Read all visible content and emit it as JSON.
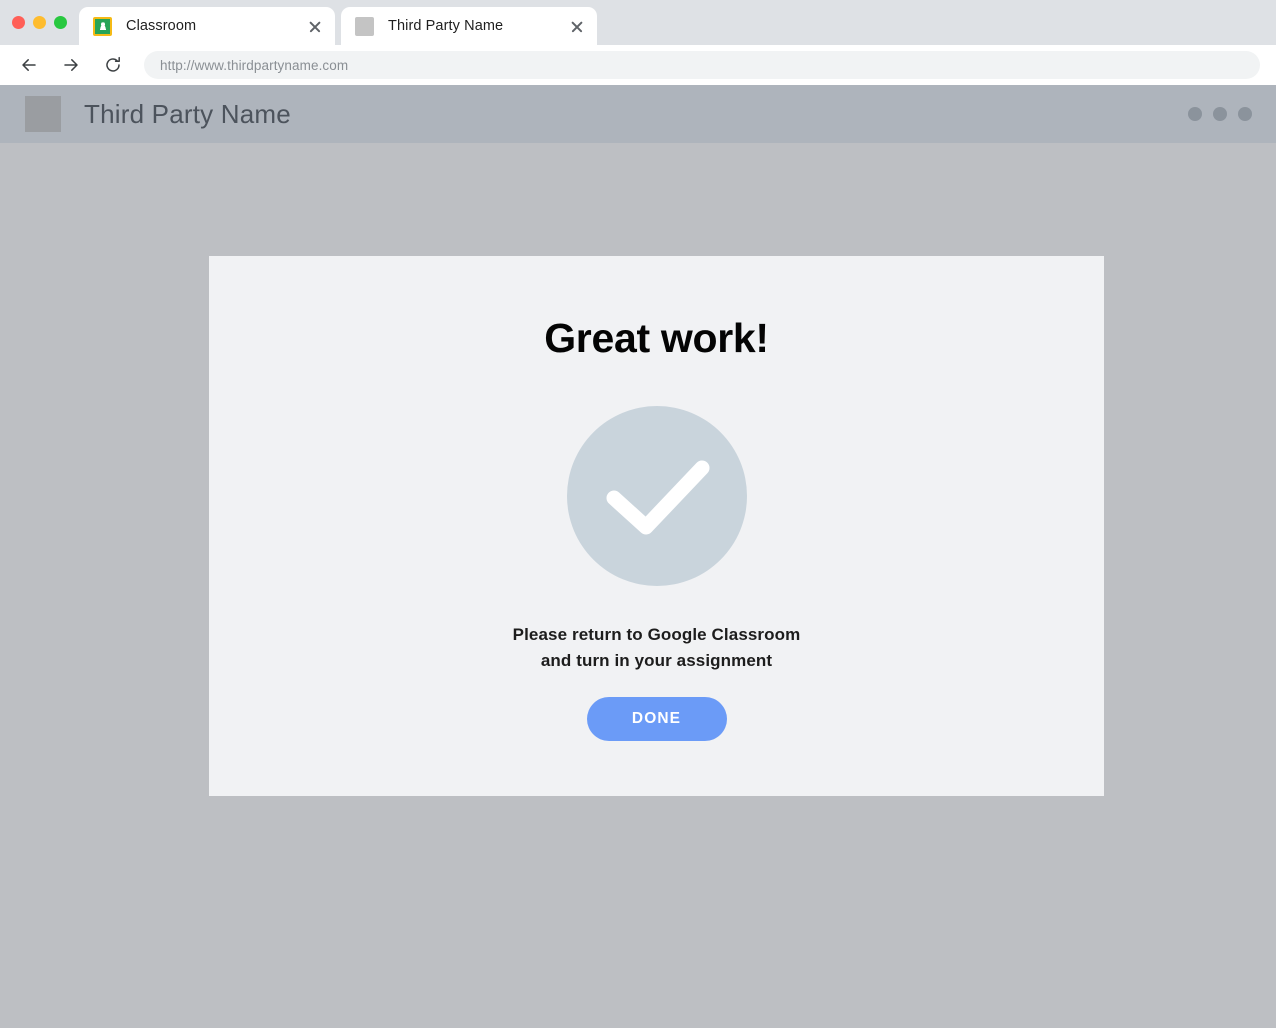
{
  "browser": {
    "traffic_lights": [
      {
        "name": "close-window-button",
        "color": "#ff5f57"
      },
      {
        "name": "minimize-window-button",
        "color": "#febc2e"
      },
      {
        "name": "maximize-window-button",
        "color": "#28c840"
      }
    ],
    "tabs": [
      {
        "title": "Classroom",
        "favicon": "google-classroom-icon",
        "active": false
      },
      {
        "title": "Third Party Name",
        "favicon": "generic-site-icon",
        "active": true
      }
    ],
    "toolbar": {
      "back_icon": "back-arrow-icon",
      "forward_icon": "forward-arrow-icon",
      "reload_icon": "reload-icon",
      "url": "http://www.thirdpartyname.com"
    }
  },
  "site_header": {
    "logo_icon": "site-logo-placeholder-icon",
    "title": "Third Party Name",
    "menu_icon": "three-dots-menu-icon",
    "background_color": "#aeb4bc"
  },
  "card": {
    "heading": "Great work!",
    "status_icon": "checkmark-circle-icon",
    "status_icon_color": "#c9d4dc",
    "message_line_1": "Please return to Google Classroom",
    "message_line_2": "and turn in your assignment",
    "done_label": "DONE",
    "done_color": "#6b9bf7",
    "background_color": "#f1f2f4"
  },
  "page": {
    "background_color": "#bdbfc3"
  }
}
